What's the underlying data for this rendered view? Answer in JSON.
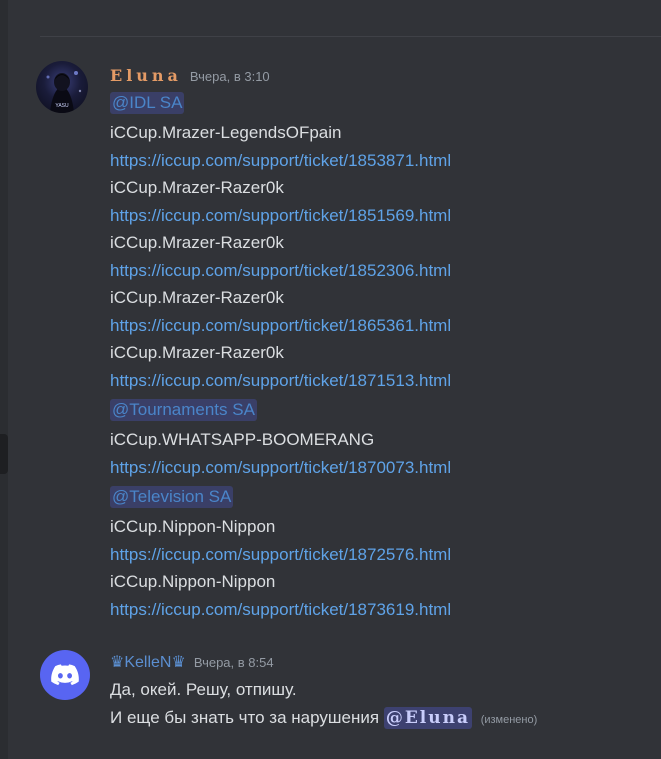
{
  "messages": [
    {
      "author": "Eluna",
      "time": "Вчера, в 3:10",
      "avatar_caption": "YASU",
      "mentions": [
        "@IDL SA",
        "@Tournaments SA",
        "@Television SA"
      ],
      "lines": [
        "iCCup.Mrazer-LegendsOFpain",
        "https://iccup.com/support/ticket/1853871.html",
        "iCCup.Mrazer-Razer0k",
        "https://iccup.com/support/ticket/1851569.html",
        "iCCup.Mrazer-Razer0k",
        "https://iccup.com/support/ticket/1852306.html",
        "iCCup.Mrazer-Razer0k",
        "https://iccup.com/support/ticket/1865361.html",
        "iCCup.Mrazer-Razer0k",
        "https://iccup.com/support/ticket/1871513.html",
        "iCCup.WHATSAPP-BOOMERANG",
        "https://iccup.com/support/ticket/1870073.html",
        "iCCup.Nippon-Nippon",
        "https://iccup.com/support/ticket/1872576.html",
        "iCCup.Nippon-Nippon",
        "https://iccup.com/support/ticket/1873619.html"
      ]
    },
    {
      "author": "♛KelleN♛",
      "time": "Вчера, в 8:54",
      "line1": "Да, окей. Решу, отпишу.",
      "line2": "И еще бы знать что за нарушения",
      "mention": "@Eluna",
      "edited": "(изменено)"
    }
  ],
  "colors": {
    "background": "#313338",
    "link": "#5fa3e8",
    "mention_bg": "rgba(88,101,242,0.25)",
    "eluna_name": "#e49b66",
    "kellen_name": "#5b8fd1",
    "discord_blurple": "#5865f2"
  },
  "icons": {
    "discord_avatar": "discord-logo-icon"
  }
}
